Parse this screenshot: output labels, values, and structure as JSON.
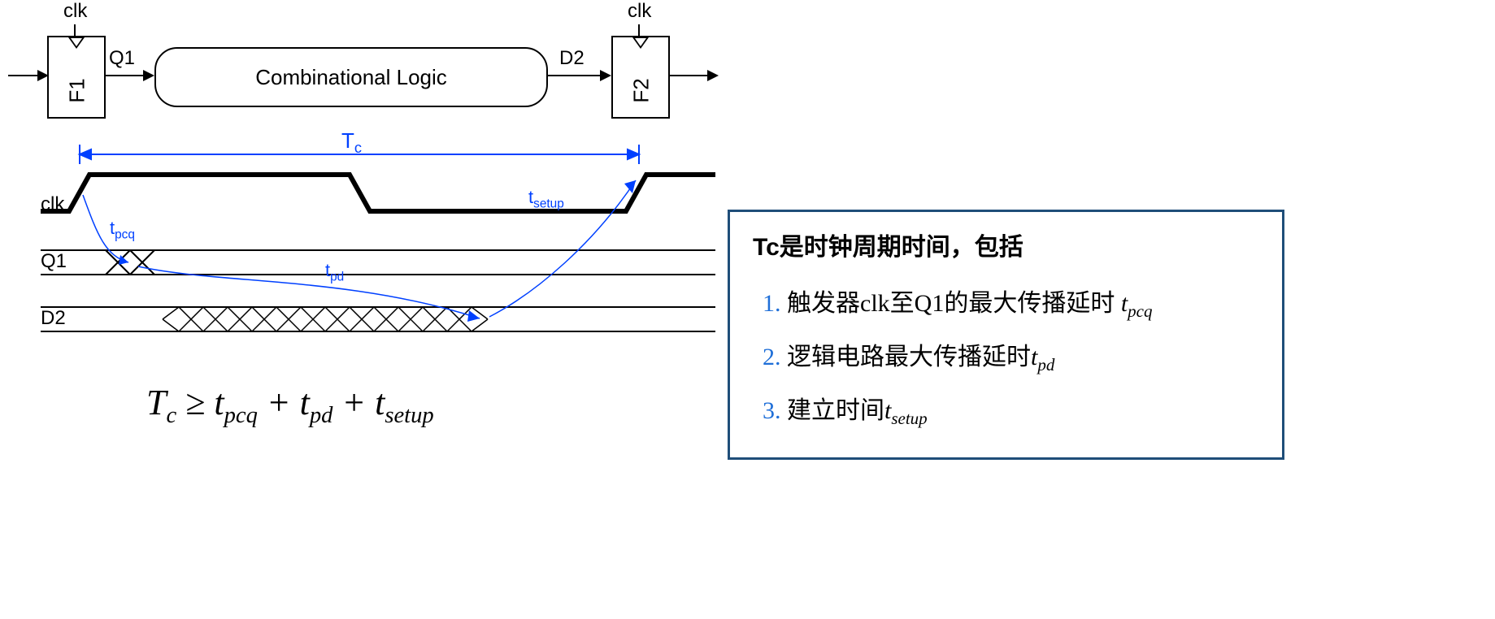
{
  "circuit": {
    "clk1": "clk",
    "clk2": "clk",
    "ff1": "F1",
    "ff2": "F2",
    "q1": "Q1",
    "d2": "D2",
    "comb": "Combinational Logic"
  },
  "timing": {
    "tc": "T",
    "tc_sub": "c",
    "tpcq": "t",
    "tpcq_sub": "pcq",
    "tpd": "t",
    "tpd_sub": "pd",
    "tsetup": "t",
    "tsetup_sub": "setup",
    "sig_clk": "clk",
    "sig_q1": "Q1",
    "sig_d2": "D2"
  },
  "equation": {
    "lhs": "T",
    "lhs_sub": "c",
    "op": " ≥ ",
    "a": "t",
    "a_sub": "pcq",
    "plus1": " + ",
    "b": "t",
    "b_sub": "pd",
    "plus2": " + ",
    "c": "t",
    "c_sub": "setup"
  },
  "card": {
    "title": "Tc是时钟周期时间，包括",
    "items": [
      {
        "pre": "触发器clk至Q1的最大传播延时 ",
        "sym": "t",
        "sub": "pcq",
        "post": ""
      },
      {
        "pre": "逻辑电路最大传播延时",
        "sym": "t",
        "sub": "pd",
        "post": ""
      },
      {
        "pre": "建立时间",
        "sym": "t",
        "sub": "setup",
        "post": ""
      }
    ]
  }
}
